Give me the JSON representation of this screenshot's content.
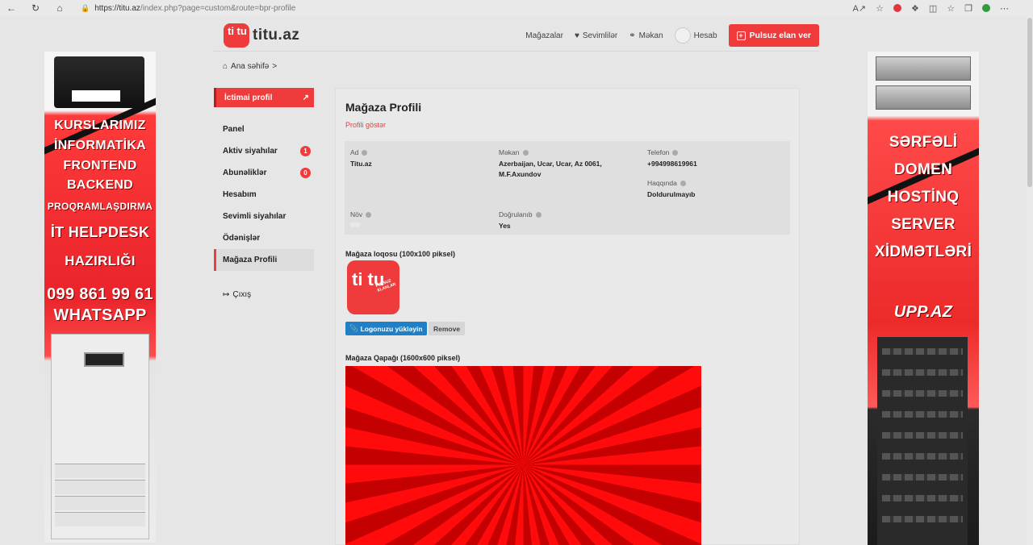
{
  "browser": {
    "url_host": "https://titu.az",
    "url_path": "/index.php?page=custom&route=bpr-profile",
    "nav_icons": [
      "back-icon",
      "reload-icon",
      "home-icon"
    ]
  },
  "header": {
    "logo_mark": "ti tu",
    "logo_text": "titu.az",
    "nav": {
      "stores": "Mağazalar",
      "favorites": "Sevimlilər",
      "location": "Məkan",
      "account": "Hesab"
    },
    "post_button": "Pulsuz elan ver"
  },
  "breadcrumb": {
    "home": "Ana səhifə",
    "separator": ">"
  },
  "sidebar": {
    "public_profile": "İctimai profil",
    "items": [
      {
        "label": "Panel",
        "badge": ""
      },
      {
        "label": "Aktiv siyahılar",
        "badge": "1"
      },
      {
        "label": "Abunəliklər",
        "badge": "0"
      },
      {
        "label": "Hesabım",
        "badge": ""
      },
      {
        "label": "Sevimli siyahılar",
        "badge": ""
      },
      {
        "label": "Ödənişlər",
        "badge": ""
      },
      {
        "label": "Mağaza Profili",
        "badge": ""
      }
    ],
    "logout": "Çıxış"
  },
  "main": {
    "title": "Mağaza Profili",
    "show_profile": "Profili göstər",
    "fields": {
      "name": {
        "label": "Ad",
        "value": "Titu.az"
      },
      "location": {
        "label": "Məkan",
        "value": "Azerbaijan, Ucar, Ucar, Az 0061, M.F.Axundov"
      },
      "phone": {
        "label": "Telefon",
        "value": "+994998619961"
      },
      "about": {
        "label": "Haqqında",
        "value": "Doldurulmayıb"
      },
      "type": {
        "label": "Növ",
        "value": ""
      },
      "verified": {
        "label": "Doğrulanıb",
        "value": "Yes"
      }
    },
    "logo_section": "Mağaza loqosu (100x100 piksel)",
    "logo_tile": {
      "big": "ti tu",
      "small": "PULSUZ ELANLAR"
    },
    "upload_button": "Logonuzu yükləyin",
    "remove_button": "Remove",
    "cover_section": "Mağaza Qapağı (1600x600 piksel)"
  },
  "ads": {
    "left": {
      "lines": [
        "KURSLARIMIZ",
        "İNFORMATİKA",
        "FRONTEND",
        "BACKEND",
        "PROQRAMLAŞDIRMA",
        "İT HELPDESK",
        "HAZIRLIĞI",
        "099 861 99 61",
        "WHATSAPP"
      ]
    },
    "right": {
      "lines": [
        "SƏRFƏLİ",
        "DOMEN",
        "HOSTİNQ",
        "SERVER",
        "XİDMƏTLƏRİ"
      ],
      "brand": "UPP.AZ"
    }
  },
  "colors": {
    "brand_red": "#ef3b3b",
    "upload_blue": "#1f80c8"
  }
}
